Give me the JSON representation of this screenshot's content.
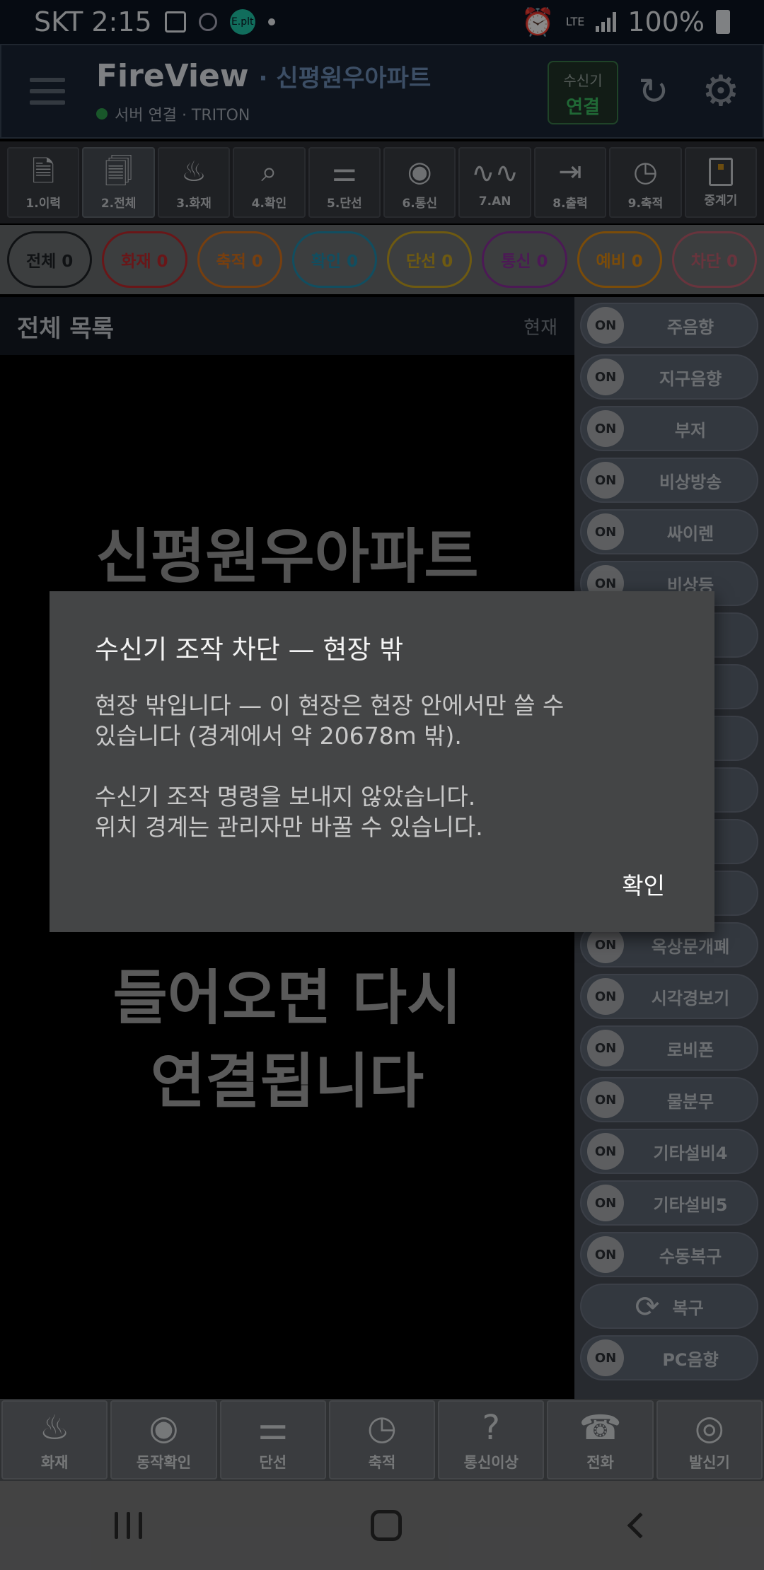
{
  "status_bar": {
    "carrier_time": "SKT 2:15",
    "badge": "E.plt",
    "network": "LTE",
    "battery": "100%"
  },
  "header": {
    "app_title": "FireView",
    "site": "· 신평원우아파트",
    "server_status": "서버 연결 · TRITON",
    "receiver_label": "수신기",
    "receiver_status": "연결"
  },
  "toolbar": [
    {
      "label": "1.이력",
      "icon": "document-icon"
    },
    {
      "label": "2.전체",
      "icon": "documents-icon"
    },
    {
      "label": "3.화재",
      "icon": "fire-icon"
    },
    {
      "label": "4.확인",
      "icon": "search-check-icon"
    },
    {
      "label": "5.단선",
      "icon": "broken-line-icon"
    },
    {
      "label": "6.통신",
      "icon": "satellite-icon"
    },
    {
      "label": "7.AN",
      "icon": "wave-icon"
    },
    {
      "label": "8.출력",
      "icon": "output-icon"
    },
    {
      "label": "9.축적",
      "icon": "timer-icon"
    },
    {
      "label": "중계기",
      "icon": "repeater-icon"
    }
  ],
  "filters": [
    {
      "label": "전체 0",
      "color": "#1e2226"
    },
    {
      "label": "화재 0",
      "color": "#c0282c"
    },
    {
      "label": "축적 0",
      "color": "#d9741c"
    },
    {
      "label": "확인 0",
      "color": "#1f8fb0"
    },
    {
      "label": "단선 0",
      "color": "#c9a420"
    },
    {
      "label": "통신 0",
      "color": "#8a2f9c"
    },
    {
      "label": "예비 0",
      "color": "#e08a12"
    },
    {
      "label": "차단 0",
      "color": "#c06070"
    }
  ],
  "list": {
    "title": "전체 목록",
    "now": "현재"
  },
  "main": {
    "site_big": "신평원우아파트",
    "msg_line1": "들어오면 다시",
    "msg_line2": "연결됩니다"
  },
  "right_panel": {
    "on_label": "ON",
    "items": [
      "주음향",
      "지구음향",
      "부저",
      "비상방송",
      "싸이렌",
      "비상등",
      "",
      "",
      "",
      "",
      "",
      "",
      "옥상문개폐",
      "시각경보기",
      "로비폰",
      "물분무",
      "기타설비4",
      "기타설비5",
      "수동복구"
    ],
    "restore_label": "복구",
    "pc_sound": "PC음향"
  },
  "bottom_bar": [
    {
      "label": "화재",
      "icon": "fire-icon"
    },
    {
      "label": "동작확인",
      "icon": "eye-icon"
    },
    {
      "label": "단선",
      "icon": "broken-line-icon"
    },
    {
      "label": "축적",
      "icon": "timer-icon"
    },
    {
      "label": "통신이상",
      "icon": "satellite-question-icon"
    },
    {
      "label": "전화",
      "icon": "telephone-icon"
    },
    {
      "label": "발신기",
      "icon": "bell-icon"
    }
  ],
  "dialog": {
    "title": "수신기 조작 차단 — 현장 밖",
    "body_line1": "현장 밖입니다 — 이 현장은 현장 안에서만 쓸 수",
    "body_line2": "있습니다 (경계에서 약 20678m 밖).",
    "body_line3": "수신기 조작 명령을 보내지 않았습니다.",
    "body_line4": "위치 경계는 관리자만 바꿀 수 있습니다.",
    "ok_label": "확인"
  }
}
